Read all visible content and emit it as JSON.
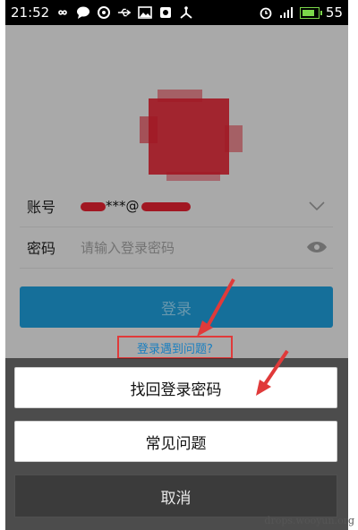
{
  "status_bar": {
    "time": "21:52",
    "battery_level": "55",
    "left_icons": [
      "infinity-icon",
      "chat-bubble-icon",
      "sync-icon",
      "usb-icon",
      "image-icon",
      "notification-icon",
      "share-icon"
    ],
    "right_icons": [
      "alarm-icon",
      "signal-icon",
      "battery-icon"
    ]
  },
  "login_form": {
    "account_label": "账号",
    "account_value": "***@",
    "password_label": "密码",
    "password_placeholder": "请输入登录密码",
    "login_button": "登录",
    "trouble_link": "登录遇到问题?"
  },
  "action_sheet": {
    "recover_password": "找回登录密码",
    "faq": "常见问题",
    "cancel": "取消"
  },
  "colors": {
    "annotation_red": "#e03a3a",
    "primary_blue": "#1e9ad6",
    "link_blue": "#1a7fc0"
  },
  "watermark": "drops.wooyun.org"
}
